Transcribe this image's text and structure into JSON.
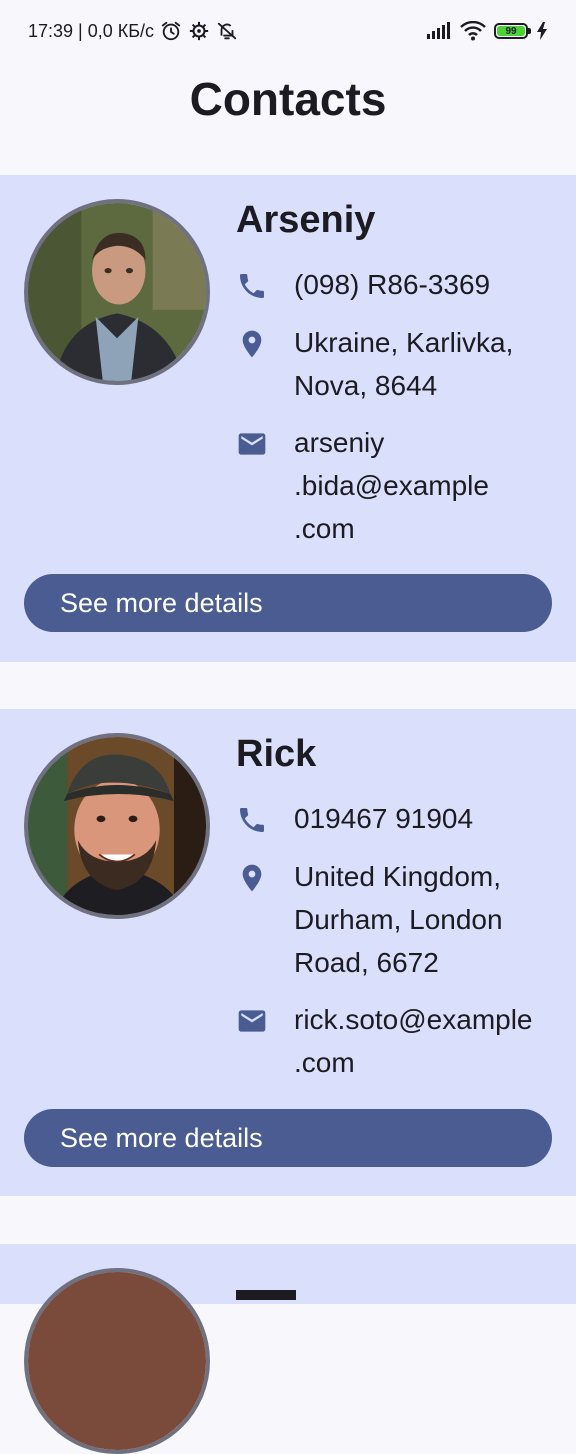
{
  "status_bar": {
    "time_and_speed": "17:39 | 0,0 КБ/с",
    "battery_level": "99",
    "icons": [
      "alarm-icon",
      "settings-gear-icon",
      "silent-bell-icon",
      "signal-icon",
      "wifi-icon",
      "battery-icon",
      "charging-bolt-icon"
    ]
  },
  "page": {
    "title": "Contacts"
  },
  "contacts": [
    {
      "name": "Arseniy",
      "phone": "(098) R86-3369",
      "address": "Ukraine, Karlivka,\nNova, 8644",
      "email": "arseniy\n.bida@example\n.com",
      "button_label": "See more details"
    },
    {
      "name": "Rick",
      "phone": "019467 91904",
      "address": "United Kingdom,\nDurham, London\nRoad, 6672",
      "email": "rick.soto@example\n.com",
      "button_label": "See more details"
    }
  ],
  "colors": {
    "card_background": "#dadffc",
    "button": "#4a5c92",
    "icon": "#4a5c92",
    "page_background": "#f8f8fc"
  }
}
